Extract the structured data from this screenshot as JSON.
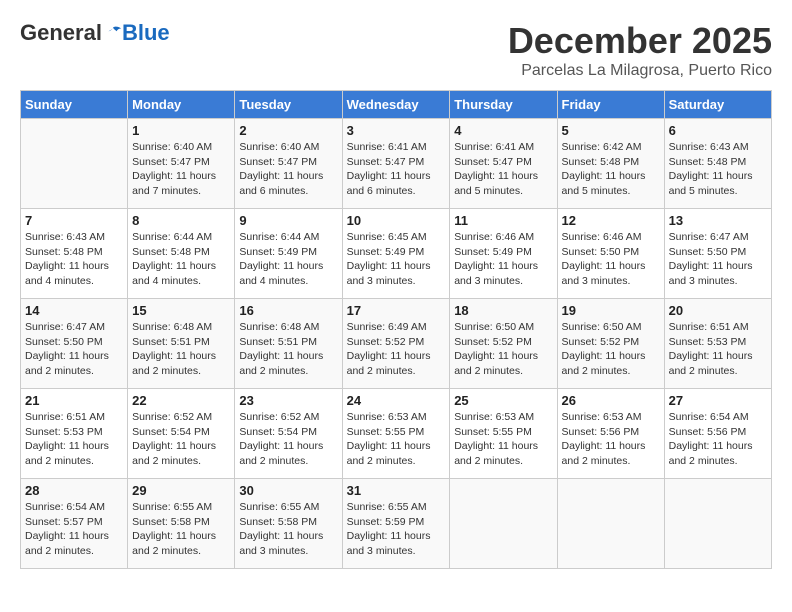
{
  "header": {
    "logo_general": "General",
    "logo_blue": "Blue",
    "title": "December 2025",
    "subtitle": "Parcelas La Milagrosa, Puerto Rico"
  },
  "weekdays": [
    "Sunday",
    "Monday",
    "Tuesday",
    "Wednesday",
    "Thursday",
    "Friday",
    "Saturday"
  ],
  "weeks": [
    [
      {
        "day": "",
        "sunrise": "",
        "sunset": "",
        "daylight": ""
      },
      {
        "day": "1",
        "sunrise": "Sunrise: 6:40 AM",
        "sunset": "Sunset: 5:47 PM",
        "daylight": "Daylight: 11 hours and 7 minutes."
      },
      {
        "day": "2",
        "sunrise": "Sunrise: 6:40 AM",
        "sunset": "Sunset: 5:47 PM",
        "daylight": "Daylight: 11 hours and 6 minutes."
      },
      {
        "day": "3",
        "sunrise": "Sunrise: 6:41 AM",
        "sunset": "Sunset: 5:47 PM",
        "daylight": "Daylight: 11 hours and 6 minutes."
      },
      {
        "day": "4",
        "sunrise": "Sunrise: 6:41 AM",
        "sunset": "Sunset: 5:47 PM",
        "daylight": "Daylight: 11 hours and 5 minutes."
      },
      {
        "day": "5",
        "sunrise": "Sunrise: 6:42 AM",
        "sunset": "Sunset: 5:48 PM",
        "daylight": "Daylight: 11 hours and 5 minutes."
      },
      {
        "day": "6",
        "sunrise": "Sunrise: 6:43 AM",
        "sunset": "Sunset: 5:48 PM",
        "daylight": "Daylight: 11 hours and 5 minutes."
      }
    ],
    [
      {
        "day": "7",
        "sunrise": "Sunrise: 6:43 AM",
        "sunset": "Sunset: 5:48 PM",
        "daylight": "Daylight: 11 hours and 4 minutes."
      },
      {
        "day": "8",
        "sunrise": "Sunrise: 6:44 AM",
        "sunset": "Sunset: 5:48 PM",
        "daylight": "Daylight: 11 hours and 4 minutes."
      },
      {
        "day": "9",
        "sunrise": "Sunrise: 6:44 AM",
        "sunset": "Sunset: 5:49 PM",
        "daylight": "Daylight: 11 hours and 4 minutes."
      },
      {
        "day": "10",
        "sunrise": "Sunrise: 6:45 AM",
        "sunset": "Sunset: 5:49 PM",
        "daylight": "Daylight: 11 hours and 3 minutes."
      },
      {
        "day": "11",
        "sunrise": "Sunrise: 6:46 AM",
        "sunset": "Sunset: 5:49 PM",
        "daylight": "Daylight: 11 hours and 3 minutes."
      },
      {
        "day": "12",
        "sunrise": "Sunrise: 6:46 AM",
        "sunset": "Sunset: 5:50 PM",
        "daylight": "Daylight: 11 hours and 3 minutes."
      },
      {
        "day": "13",
        "sunrise": "Sunrise: 6:47 AM",
        "sunset": "Sunset: 5:50 PM",
        "daylight": "Daylight: 11 hours and 3 minutes."
      }
    ],
    [
      {
        "day": "14",
        "sunrise": "Sunrise: 6:47 AM",
        "sunset": "Sunset: 5:50 PM",
        "daylight": "Daylight: 11 hours and 2 minutes."
      },
      {
        "day": "15",
        "sunrise": "Sunrise: 6:48 AM",
        "sunset": "Sunset: 5:51 PM",
        "daylight": "Daylight: 11 hours and 2 minutes."
      },
      {
        "day": "16",
        "sunrise": "Sunrise: 6:48 AM",
        "sunset": "Sunset: 5:51 PM",
        "daylight": "Daylight: 11 hours and 2 minutes."
      },
      {
        "day": "17",
        "sunrise": "Sunrise: 6:49 AM",
        "sunset": "Sunset: 5:52 PM",
        "daylight": "Daylight: 11 hours and 2 minutes."
      },
      {
        "day": "18",
        "sunrise": "Sunrise: 6:50 AM",
        "sunset": "Sunset: 5:52 PM",
        "daylight": "Daylight: 11 hours and 2 minutes."
      },
      {
        "day": "19",
        "sunrise": "Sunrise: 6:50 AM",
        "sunset": "Sunset: 5:52 PM",
        "daylight": "Daylight: 11 hours and 2 minutes."
      },
      {
        "day": "20",
        "sunrise": "Sunrise: 6:51 AM",
        "sunset": "Sunset: 5:53 PM",
        "daylight": "Daylight: 11 hours and 2 minutes."
      }
    ],
    [
      {
        "day": "21",
        "sunrise": "Sunrise: 6:51 AM",
        "sunset": "Sunset: 5:53 PM",
        "daylight": "Daylight: 11 hours and 2 minutes."
      },
      {
        "day": "22",
        "sunrise": "Sunrise: 6:52 AM",
        "sunset": "Sunset: 5:54 PM",
        "daylight": "Daylight: 11 hours and 2 minutes."
      },
      {
        "day": "23",
        "sunrise": "Sunrise: 6:52 AM",
        "sunset": "Sunset: 5:54 PM",
        "daylight": "Daylight: 11 hours and 2 minutes."
      },
      {
        "day": "24",
        "sunrise": "Sunrise: 6:53 AM",
        "sunset": "Sunset: 5:55 PM",
        "daylight": "Daylight: 11 hours and 2 minutes."
      },
      {
        "day": "25",
        "sunrise": "Sunrise: 6:53 AM",
        "sunset": "Sunset: 5:55 PM",
        "daylight": "Daylight: 11 hours and 2 minutes."
      },
      {
        "day": "26",
        "sunrise": "Sunrise: 6:53 AM",
        "sunset": "Sunset: 5:56 PM",
        "daylight": "Daylight: 11 hours and 2 minutes."
      },
      {
        "day": "27",
        "sunrise": "Sunrise: 6:54 AM",
        "sunset": "Sunset: 5:56 PM",
        "daylight": "Daylight: 11 hours and 2 minutes."
      }
    ],
    [
      {
        "day": "28",
        "sunrise": "Sunrise: 6:54 AM",
        "sunset": "Sunset: 5:57 PM",
        "daylight": "Daylight: 11 hours and 2 minutes."
      },
      {
        "day": "29",
        "sunrise": "Sunrise: 6:55 AM",
        "sunset": "Sunset: 5:58 PM",
        "daylight": "Daylight: 11 hours and 2 minutes."
      },
      {
        "day": "30",
        "sunrise": "Sunrise: 6:55 AM",
        "sunset": "Sunset: 5:58 PM",
        "daylight": "Daylight: 11 hours and 3 minutes."
      },
      {
        "day": "31",
        "sunrise": "Sunrise: 6:55 AM",
        "sunset": "Sunset: 5:59 PM",
        "daylight": "Daylight: 11 hours and 3 minutes."
      },
      {
        "day": "",
        "sunrise": "",
        "sunset": "",
        "daylight": ""
      },
      {
        "day": "",
        "sunrise": "",
        "sunset": "",
        "daylight": ""
      },
      {
        "day": "",
        "sunrise": "",
        "sunset": "",
        "daylight": ""
      }
    ]
  ]
}
